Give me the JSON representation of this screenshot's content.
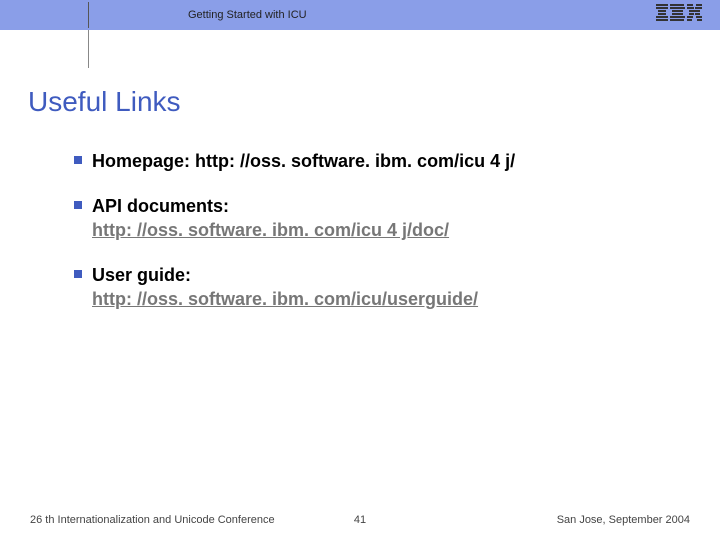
{
  "header": {
    "subtitle": "Getting Started with ICU",
    "logo": "IBM"
  },
  "title": "Useful Links",
  "bullets": [
    {
      "label": "Homepage: ",
      "inline_url": "http: //oss. software. ibm. com/icu 4 j/",
      "link_below": ""
    },
    {
      "label": "API documents:",
      "inline_url": "",
      "link_below": "http: //oss. software. ibm. com/icu 4 j/doc/"
    },
    {
      "label": "User guide:",
      "inline_url": "",
      "link_below": "http: //oss. software. ibm. com/icu/userguide/"
    }
  ],
  "footer": {
    "left": "26 th Internationalization and Unicode Conference",
    "page": "41",
    "right": "San Jose, September 2004"
  }
}
